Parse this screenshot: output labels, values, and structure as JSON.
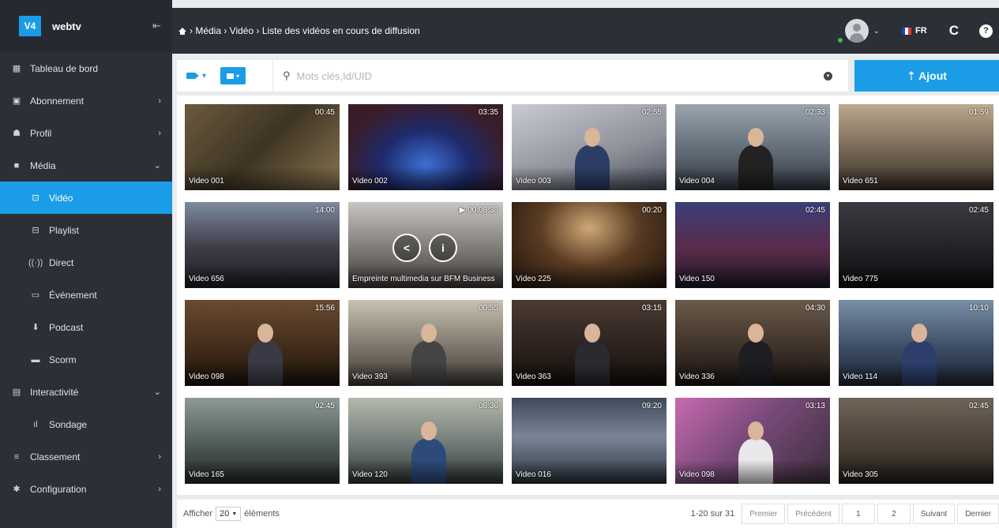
{
  "app": {
    "logo": "V4",
    "name": "webtv",
    "collapse_icon": "collapse-menu-icon"
  },
  "sidebar": {
    "items": [
      {
        "label": "Tableau de bord",
        "icon": "dashboard-icon",
        "glyph": "▦",
        "arrow": ""
      },
      {
        "label": "Abonnement",
        "icon": "id-card-icon",
        "glyph": "▣",
        "arrow": "›"
      },
      {
        "label": "Profil",
        "icon": "users-icon",
        "glyph": "☗",
        "arrow": "›"
      },
      {
        "label": "Média",
        "icon": "video-camera-icon",
        "glyph": "■",
        "arrow": "⌄"
      },
      {
        "label": "Vidéo",
        "icon": "video-square-icon",
        "glyph": "⊡",
        "arrow": ""
      },
      {
        "label": "Playlist",
        "icon": "playlist-icon",
        "glyph": "⊟",
        "arrow": ""
      },
      {
        "label": "Direct",
        "icon": "live-broadcast-icon",
        "glyph": "((·))",
        "arrow": ""
      },
      {
        "label": "Événement",
        "icon": "calendar-icon",
        "glyph": "▭",
        "arrow": ""
      },
      {
        "label": "Podcast",
        "icon": "microphone-icon",
        "glyph": "⬇",
        "arrow": ""
      },
      {
        "label": "Scorm",
        "icon": "folder-icon",
        "glyph": "▬",
        "arrow": ""
      },
      {
        "label": "Interactivité",
        "icon": "interactive-icon",
        "glyph": "▤",
        "arrow": "⌄"
      },
      {
        "label": "Sondage",
        "icon": "bar-chart-icon",
        "glyph": "ıl",
        "arrow": ""
      },
      {
        "label": "Classement",
        "icon": "sort-icon",
        "glyph": "≡",
        "arrow": "›"
      },
      {
        "label": "Configuration",
        "icon": "gear-icon",
        "glyph": "✱",
        "arrow": "›"
      }
    ]
  },
  "header": {
    "breadcrumb": "› Média › Vidéo › Liste des vidéos en cours de diffusion",
    "language": "FR",
    "refresh_glyph": "C",
    "help_glyph": "?",
    "caret": "⌄"
  },
  "toolbar": {
    "camera_caret": "▾",
    "grid_caret": "▾",
    "search_placeholder": "Mots clés,Id/UID",
    "search_glyph": "⚲",
    "dropdown_glyph": "▾",
    "add_label": "⇡ Ajout"
  },
  "videos": [
    {
      "title": "Video 001",
      "duration": "00:45"
    },
    {
      "title": "Video 002",
      "duration": "03:35"
    },
    {
      "title": "Video 003",
      "duration": "02:55"
    },
    {
      "title": "Video 004",
      "duration": "02:33"
    },
    {
      "title": "Video 651",
      "duration": "01:59"
    },
    {
      "title": "Video 656",
      "duration": "14:00"
    },
    {
      "title": "Empreinte multimedia sur BFM Business",
      "duration": "▶ 00:08:38"
    },
    {
      "title": "Video 225",
      "duration": "00:20"
    },
    {
      "title": "Video 150",
      "duration": "02:45"
    },
    {
      "title": "Video 775",
      "duration": "02:45"
    },
    {
      "title": "Video 098",
      "duration": "15:56"
    },
    {
      "title": "Video 393",
      "duration": "00:55"
    },
    {
      "title": "Video 363",
      "duration": "03:15"
    },
    {
      "title": "Video 336",
      "duration": "04:30"
    },
    {
      "title": "Video 114",
      "duration": "10:10"
    },
    {
      "title": "Video 165",
      "duration": "02:45"
    },
    {
      "title": "Video 120",
      "duration": "08:36"
    },
    {
      "title": "Video 016",
      "duration": "09:20"
    },
    {
      "title": "Video 098",
      "duration": "03:13"
    },
    {
      "title": "Video 305",
      "duration": "02:45"
    }
  ],
  "hover_controls": {
    "share_glyph": "<",
    "info_glyph": "i"
  },
  "footer": {
    "show_label": "Afficher",
    "page_size": "20",
    "elements_label": "éléments",
    "range": "1-20 sur 31",
    "first": "Premier",
    "prev": "Précédent",
    "page1": "1",
    "page2": "2",
    "next": "Suivant",
    "last": "Dernier"
  }
}
